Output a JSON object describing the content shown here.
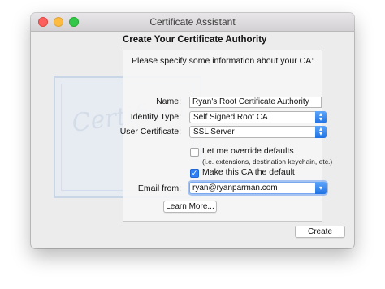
{
  "window": {
    "title": "Certificate Assistant",
    "heading": "Create Your Certificate Authority"
  },
  "illustration": {
    "text": "Certificate"
  },
  "panel": {
    "intro": "Please specify some information about your CA:",
    "name_label": "Name:",
    "name_value": "Ryan's Root Certificate Authority",
    "identity_type_label": "Identity Type:",
    "identity_type_value": "Self Signed Root CA",
    "user_certificate_label": "User Certificate:",
    "user_certificate_value": "SSL Server",
    "override_label": "Let me override defaults",
    "override_note": "(i.e. extensions, destination keychain, etc.)",
    "override_checked": false,
    "make_default_label": "Make this CA the default",
    "make_default_checked": true,
    "email_label": "Email from:",
    "email_value": "ryan@ryanparman.com",
    "learn_more_label": "Learn More..."
  },
  "footer": {
    "create_label": "Create"
  },
  "icons": {
    "popup_arrows": "up-down-chevron-icon",
    "combo_arrow": "chevron-down-icon",
    "check": "checkmark-icon"
  }
}
